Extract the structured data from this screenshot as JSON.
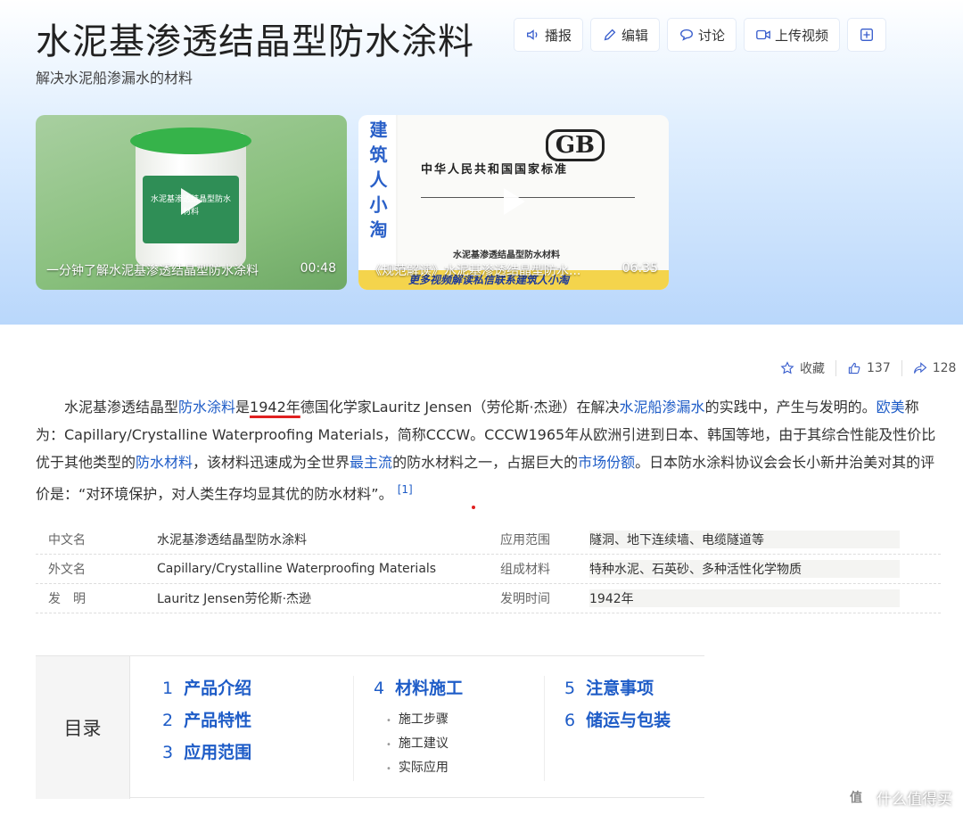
{
  "header": {
    "title": "水泥基渗透结晶型防水涂料",
    "subtitle": "解决水泥船渗漏水的材料",
    "actions": [
      "播报",
      "编辑",
      "讨论",
      "上传视频"
    ]
  },
  "videos": [
    {
      "title": "一分钟了解水泥基渗透结晶型防水涂料",
      "duration": "00:48",
      "bucket_label": "水泥基渗透结晶型防水材料"
    },
    {
      "title": "《规范解读》水泥基渗透结晶型防水...",
      "duration": "06:35",
      "side_text": "建筑人小淘",
      "doc_badge": "GB",
      "doc_heading": "中华人民共和国国家标准",
      "doc_name": "水泥基渗透结晶型防水材料",
      "band_text": "更多视频解读私信联系建筑人小淘"
    }
  ],
  "stats": {
    "collect": "收藏",
    "likes": "137",
    "shares": "128"
  },
  "intro": {
    "p1": "水泥基渗透结晶型",
    "l1": "防水涂料",
    "p2": "是",
    "u1": "1942年",
    "p3": "德国化学家Lauritz Jensen（劳伦斯·杰逊）在解决",
    "l2": "水泥船渗漏水",
    "p4": "的实践中，产生与发明的。",
    "l3": "欧美",
    "p5": "称为：Capillary/Crystalline Waterproofing Materials，简称CCCW。CCCW1965年从欧洲引进到日本、韩国等地，由于其综合性能及性价比优于其他类型的",
    "l4": "防水材料",
    "p6": "，该材料迅速成为全世界",
    "l5": "最主流",
    "p7": "的防水材料之一，占据巨大的",
    "l6": "市场份额",
    "p8": "。日本防水涂料协议会会长小新井治美对其的评价是：“对环境保护，对人类生存均显其优的防水材料”。",
    "ref": "[1]"
  },
  "infobox": [
    {
      "k": "中文名",
      "v": "水泥基渗透结晶型防水涂料",
      "k2": "应用范围",
      "v2": "隧洞、地下连续墙、电缆隧道等"
    },
    {
      "k": "外文名",
      "v": "Capillary/Crystalline Waterproofing Materials",
      "k2": "组成材料",
      "v2": "特种水泥、石英砂、多种活性化学物质"
    },
    {
      "k": "发　明",
      "v": "Lauritz Jensen劳伦斯·杰逊",
      "k2": "发明时间",
      "v2": "1942年"
    }
  ],
  "toc": {
    "label": "目录",
    "items": [
      {
        "n": "1",
        "t": "产品介绍"
      },
      {
        "n": "2",
        "t": "产品特性"
      },
      {
        "n": "3",
        "t": "应用范围"
      },
      {
        "n": "4",
        "t": "材料施工"
      },
      {
        "n": "5",
        "t": "注意事项"
      },
      {
        "n": "6",
        "t": "储运与包装"
      }
    ],
    "subs": [
      "施工步骤",
      "施工建议",
      "实际应用"
    ]
  },
  "watermark": {
    "logo": "值",
    "text": "什么值得买"
  },
  "colors": {
    "link": "#1e5cc7",
    "underline": "#e02020",
    "hero_bottom": "#b9d7fb"
  }
}
